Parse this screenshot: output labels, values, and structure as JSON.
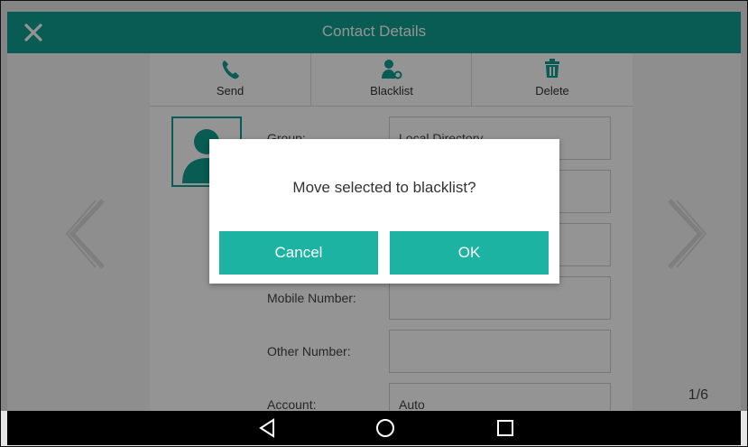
{
  "header": {
    "title": "Contact Details",
    "close_icon": "close-icon"
  },
  "toolbar": {
    "send_label": "Send",
    "blacklist_label": "Blacklist",
    "delete_label": "Delete"
  },
  "fields": {
    "group": {
      "label": "Group:",
      "value": "Local Directory"
    },
    "mobile": {
      "label": "Mobile Number:",
      "value": ""
    },
    "other": {
      "label": "Other Number:",
      "value": ""
    },
    "account": {
      "label": "Account:",
      "value": "Auto"
    }
  },
  "pagination": {
    "indicator": "1/6"
  },
  "dialog": {
    "message": "Move selected to blacklist?",
    "cancel_label": "Cancel",
    "ok_label": "OK"
  },
  "navbar": {
    "icons": [
      "back-icon",
      "home-icon",
      "recents-icon"
    ]
  },
  "colors": {
    "accent": "#0e9f8f",
    "button": "#1cb3a2",
    "navbar": "#000000"
  }
}
